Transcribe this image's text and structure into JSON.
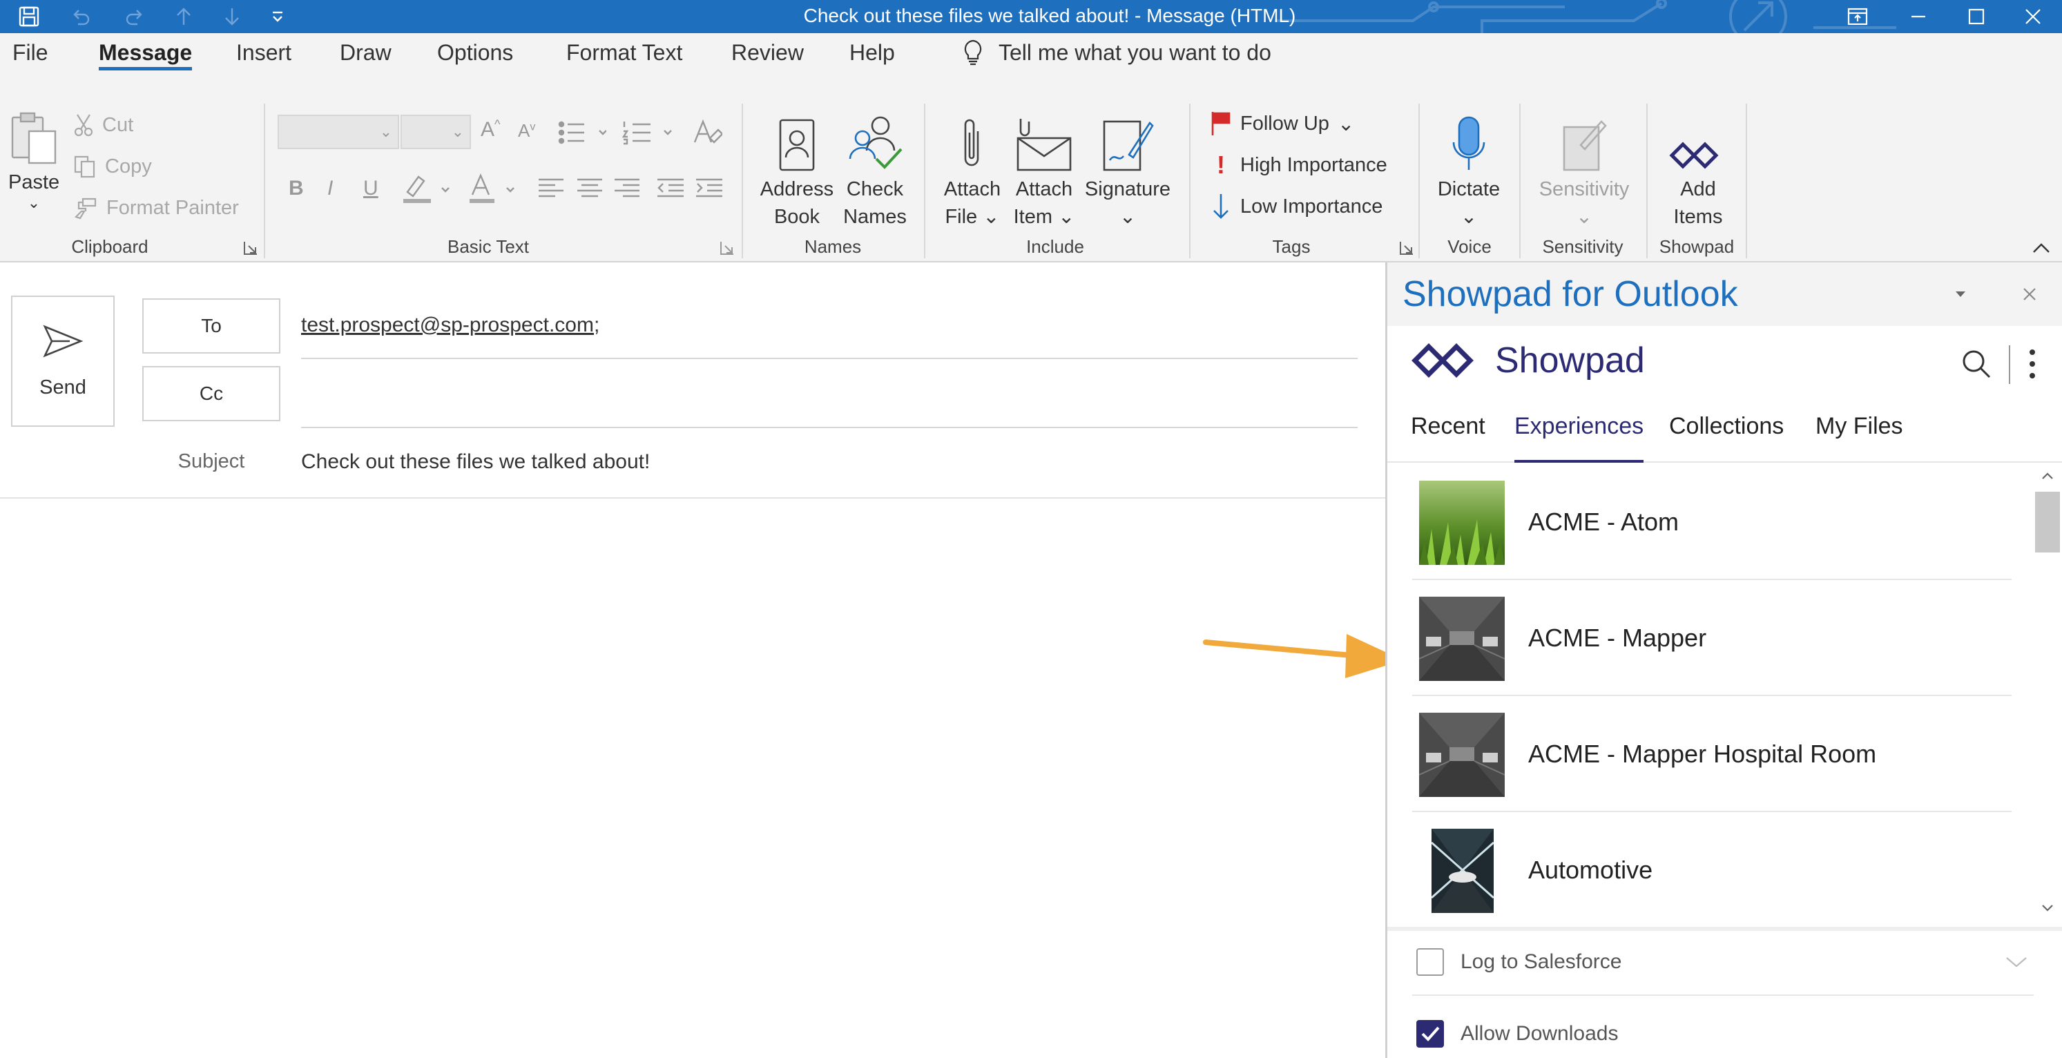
{
  "window": {
    "title": "Check out these files we talked about!  -  Message (HTML)"
  },
  "menu": {
    "tabs": [
      "File",
      "Message",
      "Insert",
      "Draw",
      "Options",
      "Format Text",
      "Review",
      "Help"
    ],
    "active": "Message",
    "tell_me": "Tell me what you want to do"
  },
  "ribbon": {
    "clipboard": {
      "paste": "Paste",
      "cut": "Cut",
      "copy": "Copy",
      "format_painter": "Format Painter",
      "label": "Clipboard"
    },
    "basic_text": {
      "label": "Basic Text",
      "bold": "B",
      "italic": "I",
      "underline": "U"
    },
    "names": {
      "address": [
        "Address",
        "Book"
      ],
      "check": [
        "Check",
        "Names"
      ],
      "label": "Names"
    },
    "include": {
      "attach_file": [
        "Attach",
        "File"
      ],
      "attach_item": [
        "Attach",
        "Item"
      ],
      "signature": "Signature",
      "label": "Include"
    },
    "tags": {
      "follow_up": "Follow Up",
      "high": "High Importance",
      "low": "Low Importance",
      "label": "Tags"
    },
    "voice": {
      "dictate": "Dictate",
      "label": "Voice"
    },
    "sensitivity": {
      "button": "Sensitivity",
      "label": "Sensitivity"
    },
    "showpad": {
      "add": [
        "Add",
        "Items"
      ],
      "label": "Showpad"
    }
  },
  "compose": {
    "send": "Send",
    "to_label": "To",
    "to_value": "test.prospect@sp-prospect.com",
    "to_suffix": ";",
    "cc_label": "Cc",
    "subject_label": "Subject",
    "subject_value": "Check out these files we talked about!"
  },
  "pane": {
    "title": "Showpad for Outlook",
    "brand": "Showpad",
    "tabs": [
      "Recent",
      "Experiences",
      "Collections",
      "My Files"
    ],
    "active_tab": "Experiences",
    "items": [
      {
        "name": "ACME - Atom",
        "thumb": "grass"
      },
      {
        "name": "ACME - Mapper",
        "thumb": "corridor"
      },
      {
        "name": "ACME - Mapper Hospital Room",
        "thumb": "corridor"
      },
      {
        "name": "Automotive",
        "thumb": "tunnel"
      }
    ],
    "footer": {
      "log_salesforce": "Log to Salesforce",
      "log_checked": false,
      "allow_downloads": "Allow Downloads",
      "allow_checked": true
    }
  },
  "colors": {
    "titlebar": "#1f6fbf",
    "showpad_brand": "#2b2a72",
    "annotation_arrow": "#f2a93b"
  }
}
